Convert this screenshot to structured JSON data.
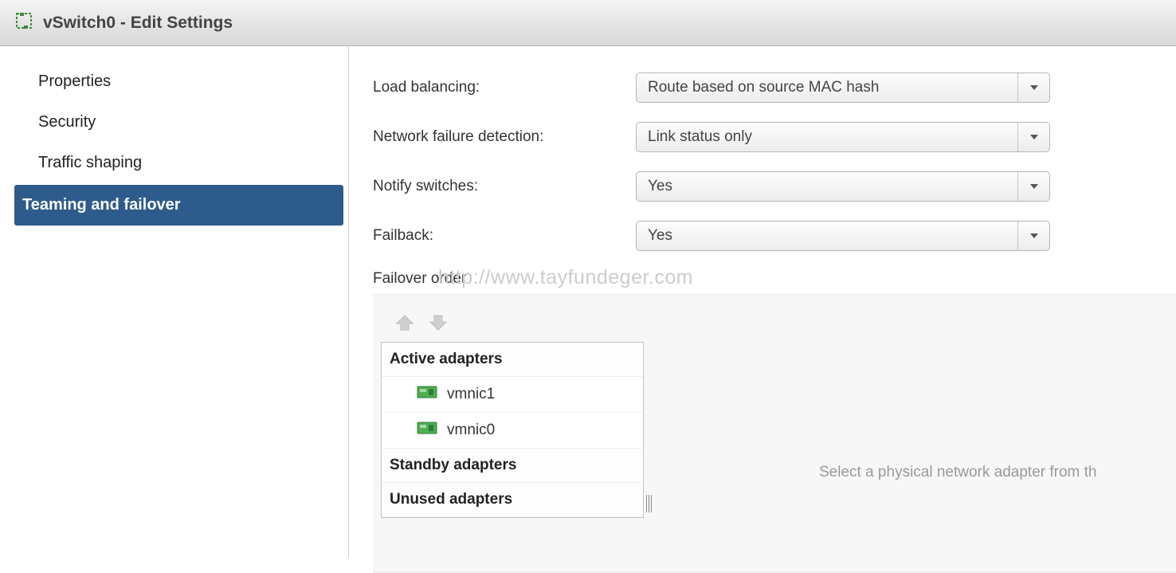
{
  "title": "vSwitch0 - Edit Settings",
  "sidebar": {
    "items": [
      {
        "label": "Properties"
      },
      {
        "label": "Security"
      },
      {
        "label": "Traffic shaping"
      },
      {
        "label": "Teaming and failover",
        "selected": true
      }
    ]
  },
  "form": {
    "load_balancing": {
      "label": "Load balancing:",
      "value": "Route based on source MAC hash"
    },
    "failure_detection": {
      "label": "Network failure detection:",
      "value": "Link status only"
    },
    "notify_switches": {
      "label": "Notify switches:",
      "value": "Yes"
    },
    "failback": {
      "label": "Failback:",
      "value": "Yes"
    }
  },
  "failover": {
    "header": "Failover order",
    "groups": {
      "active": {
        "label": "Active adapters",
        "adapters": [
          "vmnic1",
          "vmnic0"
        ]
      },
      "standby": {
        "label": "Standby adapters"
      },
      "unused": {
        "label": "Unused adapters"
      }
    },
    "hint": "Select a physical network adapter from th"
  },
  "watermark": "http://www.tayfundeger.com"
}
